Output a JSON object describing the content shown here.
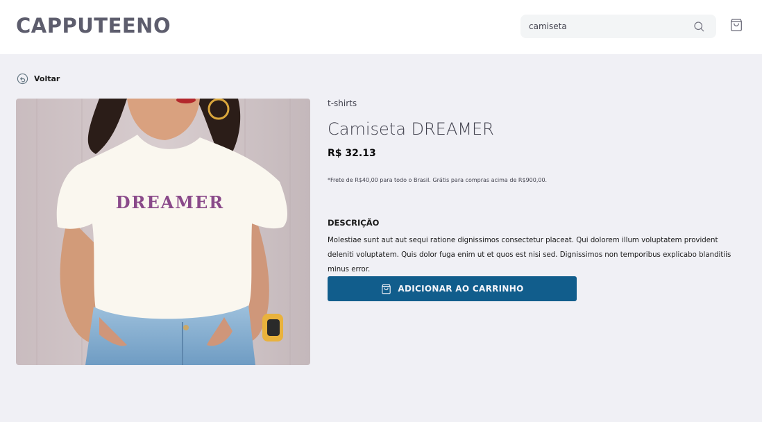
{
  "header": {
    "logo": "CAPPUTEENO",
    "search": {
      "value": "camiseta"
    }
  },
  "nav": {
    "back_label": "Voltar"
  },
  "product": {
    "category": "t-shirts",
    "title": "Camiseta DREAMER",
    "price": "R$ 32.13",
    "shipping_note": "*Frete de R$40,00 para todo o Brasil. Grátis para compras acima de R$900,00.",
    "description_heading": "DESCRIÇÃO",
    "description": "Molestiae sunt aut aut sequi ratione dignissimos consectetur placeat. Qui dolorem illum voluptatem provident deleniti voluptatem. Quis dolor fuga enim ut et quos est nisi sed. Dignissimos non temporibus explicabo blanditiis minus error.",
    "image_text": "DREAMER",
    "add_to_cart_label": "ADICIONAR AO CARRINHO"
  },
  "colors": {
    "primary_button": "#115d8c",
    "logo": "#5d5d6d",
    "background": "#f0f0f5"
  },
  "icons": [
    "search-icon",
    "shopping-bag-icon",
    "back-arrow-icon"
  ]
}
